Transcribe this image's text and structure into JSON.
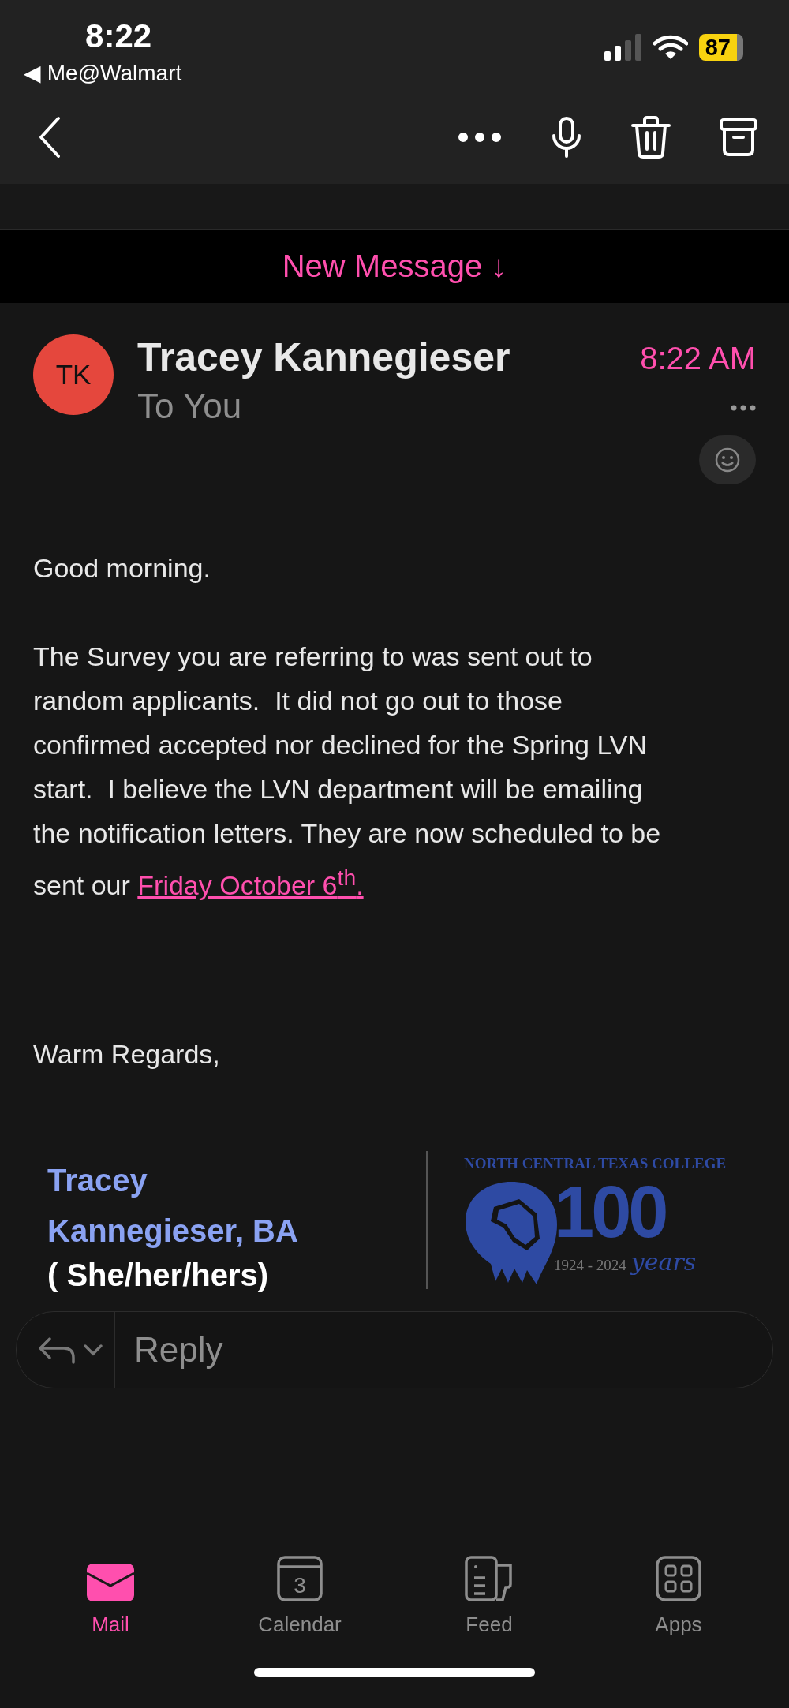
{
  "status_bar": {
    "time": "8:22",
    "back_app": "◀ Me@Walmart",
    "battery": "87"
  },
  "banner": {
    "label": "New Message ↓"
  },
  "message": {
    "avatar": "TK",
    "sender": "Tracey Kannegieser",
    "recipient": "To You",
    "time": "8:22 AM",
    "paragraphs": [
      {
        "text": "Good morning."
      },
      {
        "text": "The Survey you are referring to was sent out to random applicants.  It did not go out to those confirmed accepted nor declined for the Spring LVN start.  I believe the LVN department will be emailing the notification letters. They are now scheduled to be sent our ",
        "link": "Friday October 6$^{th}$."
      },
      {
        "text": "Warm Regards,"
      }
    ],
    "signature": {
      "name": "Tracey Kannegieser, BA",
      "pronouns": "( She/her/hers)",
      "logo_title": "NORTH CENTRAL TEXAS COLLEGE",
      "logo_number": "100",
      "logo_years": "1924 - 2024",
      "logo_script": "years"
    }
  },
  "reply": {
    "placeholder": "Reply"
  },
  "tabs": [
    {
      "label": "Mail",
      "kind": "mail",
      "selected": true
    },
    {
      "label": "Calendar",
      "kind": "calendar",
      "day": "3",
      "selected": false
    },
    {
      "label": "Feed",
      "kind": "feed",
      "selected": false
    },
    {
      "label": "Apps",
      "kind": "apps",
      "selected": false
    }
  ]
}
